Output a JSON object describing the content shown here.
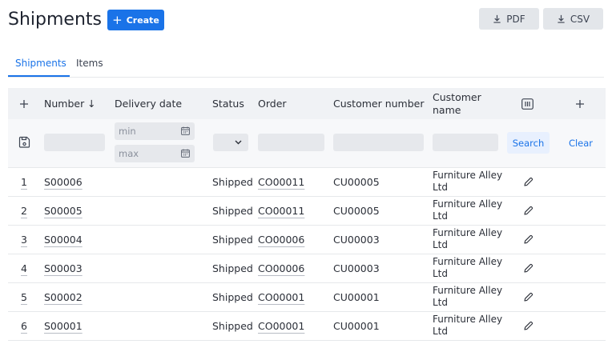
{
  "header": {
    "title": "Shipments",
    "create_label": "Create",
    "pdf_label": "PDF",
    "csv_label": "CSV"
  },
  "tabs": [
    {
      "label": "Shipments",
      "active": true
    },
    {
      "label": "Items",
      "active": false
    }
  ],
  "table": {
    "columns": {
      "number": "Number ↓",
      "delivery_date": "Delivery date",
      "status": "Status",
      "order": "Order",
      "customer_number": "Customer number",
      "customer_name": "Customer name"
    },
    "filters": {
      "date_min_placeholder": "min",
      "date_max_placeholder": "max",
      "search_label": "Search",
      "clear_label": "Clear"
    },
    "rows": [
      {
        "index": "1",
        "number": "S00006",
        "delivery_date": "",
        "status": "Shipped",
        "order": "CO00011",
        "customer_number": "CU00005",
        "customer_name": "Furniture Alley Ltd"
      },
      {
        "index": "2",
        "number": "S00005",
        "delivery_date": "",
        "status": "Shipped",
        "order": "CO00011",
        "customer_number": "CU00005",
        "customer_name": "Furniture Alley Ltd"
      },
      {
        "index": "3",
        "number": "S00004",
        "delivery_date": "",
        "status": "Shipped",
        "order": "CO00006",
        "customer_number": "CU00003",
        "customer_name": "Furniture Alley Ltd"
      },
      {
        "index": "4",
        "number": "S00003",
        "delivery_date": "",
        "status": "Shipped",
        "order": "CO00006",
        "customer_number": "CU00003",
        "customer_name": "Furniture Alley Ltd"
      },
      {
        "index": "5",
        "number": "S00002",
        "delivery_date": "",
        "status": "Shipped",
        "order": "CO00001",
        "customer_number": "CU00001",
        "customer_name": "Furniture Alley Ltd"
      },
      {
        "index": "6",
        "number": "S00001",
        "delivery_date": "",
        "status": "Shipped",
        "order": "CO00001",
        "customer_number": "CU00001",
        "customer_name": "Furniture Alley Ltd"
      }
    ]
  },
  "icons": {
    "download": "download-icon",
    "plus": "plus-icon",
    "save": "save-icon",
    "calendar": "calendar-icon",
    "chevron": "chevron-down-icon",
    "columns": "columns-icon",
    "edit": "pencil-icon"
  },
  "colors": {
    "accent": "#1a73e8",
    "header_bg": "#f0f2f5",
    "filter_bg": "#f7f8fa"
  }
}
